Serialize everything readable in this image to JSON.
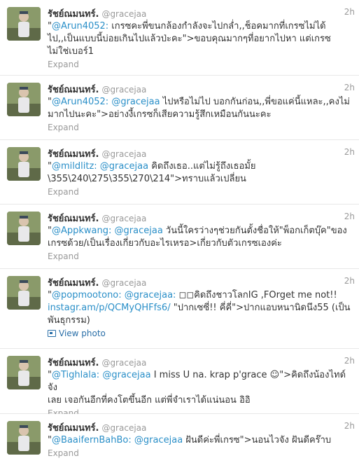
{
  "accent_color": "#2a8fc8",
  "tweets": [
    {
      "fullname": "รัชย์ณมนทร์.",
      "username": "@gracejaa",
      "time": "2h",
      "mention": "@Arun4052:",
      "text1": " เกรซคะพี่ขนกล้องกำลังจะไปกล่ำ,,ช็อคมากที่เกรซไม่ได้",
      "text2": "ไป,,เป็นแบบนี้บ่อยเกินไปแล้วป่ะคะ\">ขอบคุณมากๆที่อยากไปหา แต่เกรซ",
      "text3": "ไม่ใช่เบอร์1",
      "footer": "Expand"
    },
    {
      "fullname": "รัชย์ณมนทร์.",
      "username": "@gracejaa",
      "time": "2h",
      "mention": "@Arun4052:",
      "mention2": "@gracejaa",
      "text1": " ไปหรือไม่ไป บอกกันก่อน,,พี่ขอแค่นี้แหละ,,คงไม่",
      "text2": "มากไปนะคะ\">อย่างงี้เกรซก็เสียความรู้สึกเหมือนกันนะคะ",
      "footer": "Expand"
    },
    {
      "fullname": "รัชย์ณมนทร์.",
      "username": "@gracejaa",
      "time": "2h",
      "mention": "@mildlitz:",
      "mention2": "@gracejaa",
      "text1": " คิดถึงเธอ..แต่ไม่รู้ถึงเธอมั้ย",
      "text2": "\\355\\240\\275\\355\\270\\214\">ทราบแล้วเปลี่ยน",
      "footer": "Expand"
    },
    {
      "fullname": "รัชย์ณมนทร์.",
      "username": "@gracejaa",
      "time": "2h",
      "mention": "@Appkwang:",
      "mention2": "@gracejaa",
      "text1": " วันนี้ใครว่างๆช่วยกันตั้งชื่อให้\"พ็อกเก็ตบุ๊ค\"ของ",
      "text2": "เกรซด้วย/เป็นเรื่องเกี่ยวกับอะไรเหรอ>เกี่ยวกับตัวเกรซเองค่ะ",
      "footer": "Expand"
    },
    {
      "fullname": "รัชย์ณมนทร์.",
      "username": "@gracejaa",
      "time": "2h",
      "mention": "@popmootono:",
      "mention2": "@gracejaa:",
      "text1": " ◻◻คิดถึงชาวโลกIG ,FOrget me not!!",
      "link": "instagr.am/p/QCMyQHFfs6/",
      "text2": " \"ปากเซซี่!! คี่คี่\">ปากแอบหนานิดนึง55 (เป็น",
      "text3": "พันธุกรรม)",
      "footer": "View photo"
    },
    {
      "fullname": "รัชย์ณมนทร์.",
      "username": "@gracejaa",
      "time": "2h",
      "mention": "@Tighlala:",
      "mention2": "@gracejaa",
      "text1": " I miss U na. krap p'grace ☺\">คิดถึงน้องไทด์จัง",
      "text2": "เลย เจอกันอีกที่คงโตขึ้นอีก แต่พี่จำเราได้แน่นอน อิอิ",
      "footer": "Expand"
    },
    {
      "fullname": "รัชย์ณมนทร์.",
      "username": "@gracejaa",
      "time": "2h",
      "mention": "@BaaifernBahBo:",
      "mention2": "@gracejaa",
      "text1": " ฝันดีค่ะพี่เกรซ\">นอนไวจัง ฝันดีคร๊าบ",
      "footer": "Expand"
    }
  ]
}
